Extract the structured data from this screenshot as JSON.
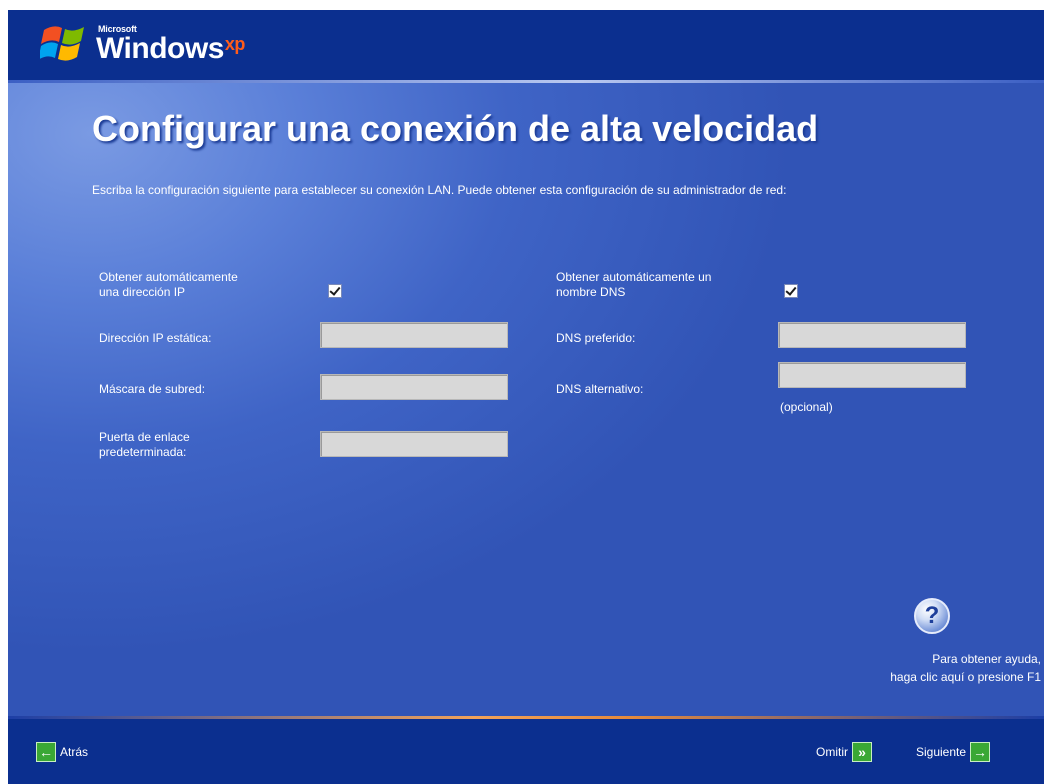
{
  "brand": {
    "microsoft": "Microsoft",
    "windows": "Windows",
    "xp": "xp"
  },
  "page": {
    "title": "Configurar una conexión de alta velocidad",
    "description": "Escriba la configuración siguiente para establecer su conexión LAN. Puede obtener esta configuración de su administrador de red:"
  },
  "ip": {
    "auto_label_line1": "Obtener automáticamente",
    "auto_label_line2": "una dirección IP",
    "auto_checked": true,
    "static_ip_label": "Dirección IP estática:",
    "static_ip_value": "",
    "subnet_label": "Máscara de subred:",
    "subnet_value": "",
    "gateway_label_line1": "Puerta de enlace",
    "gateway_label_line2": "predeterminada:",
    "gateway_value": ""
  },
  "dns": {
    "auto_label_line1": "Obtener automáticamente un",
    "auto_label_line2": "nombre DNS",
    "auto_checked": true,
    "preferred_label": "DNS preferido:",
    "preferred_value": "",
    "alternate_label": "DNS alternativo:",
    "alternate_value": "",
    "optional_note": "(opcional)"
  },
  "help": {
    "icon": "help-question-icon",
    "glyph": "?",
    "line1": "Para obtener ayuda,",
    "line2": "haga clic aquí o presione F1"
  },
  "nav": {
    "back_label": "Atrás",
    "skip_label": "Omitir",
    "next_label": "Siguiente"
  },
  "colors": {
    "topbar": "#0b2f8f",
    "main": "#3f64c6",
    "accent_arrow": "#3aa835",
    "xp": "#ff5c1a"
  }
}
